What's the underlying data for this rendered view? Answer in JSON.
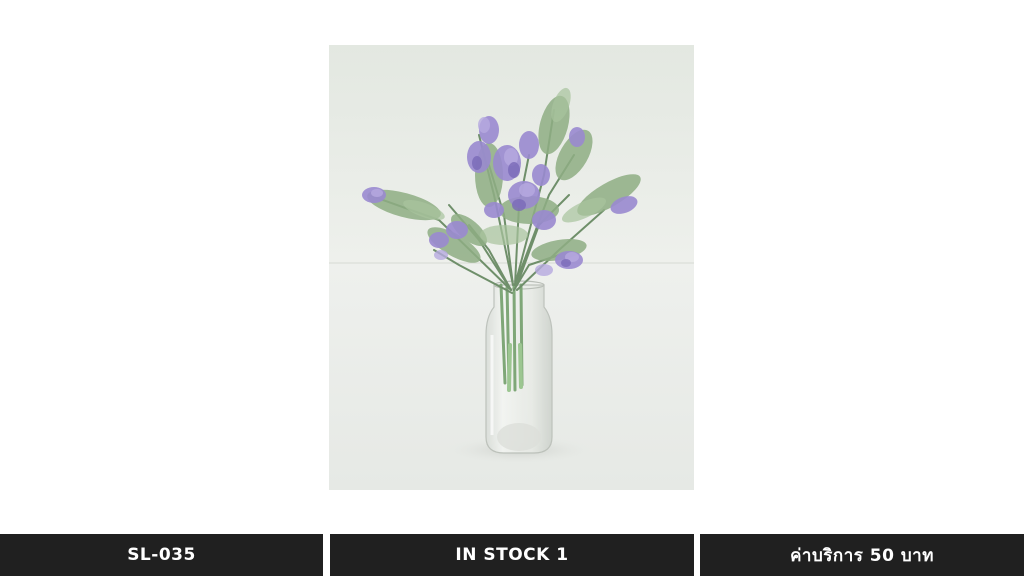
{
  "product": {
    "sku": "SL-035",
    "stock": "IN STOCK 1",
    "price": "ค่าบริการ 50 บาท",
    "image_subject": "lavender-sprigs-in-glass-bottle"
  },
  "colors": {
    "bar_background": "#202020",
    "bar_text": "#ffffff",
    "page_background": "#ffffff",
    "photo_backdrop": "#e9ece8",
    "lavender": "#9a8ad0",
    "foliage": "#8fae84"
  }
}
